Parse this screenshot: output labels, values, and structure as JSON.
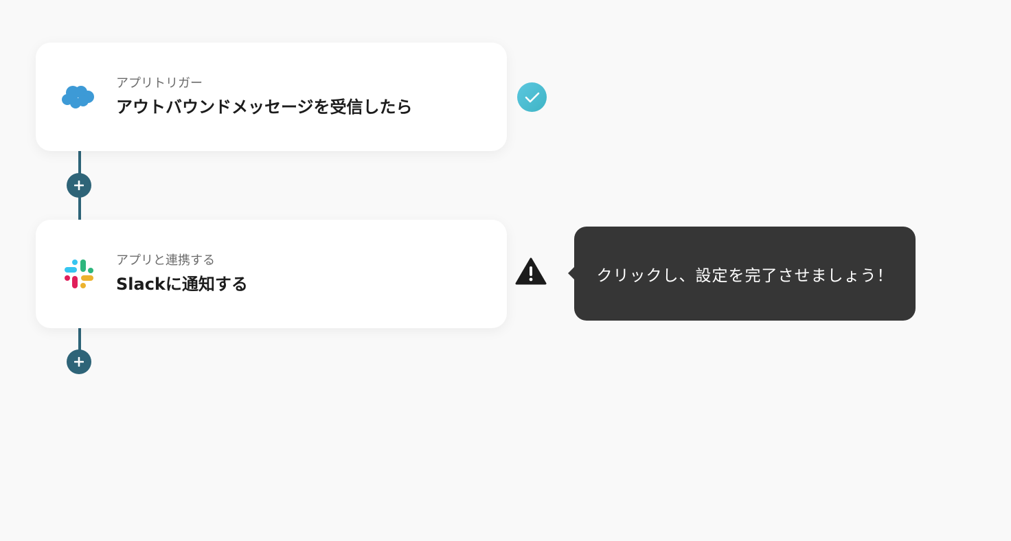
{
  "flow": {
    "steps": [
      {
        "subtitle": "アプリトリガー",
        "title": "アウトバウンドメッセージを受信したら",
        "icon": "salesforce-cloud-icon",
        "status": "completed",
        "status_icon": "check-circle-icon"
      },
      {
        "subtitle": "アプリと連携する",
        "title": "Slackに通知する",
        "icon": "slack-icon",
        "status": "incomplete",
        "status_icon": "warning-triangle-icon"
      }
    ],
    "add_buttons": [
      {
        "icon": "plus-icon"
      },
      {
        "icon": "plus-icon"
      }
    ]
  },
  "tooltip": {
    "text": "クリックし、設定を完了させましょう！"
  },
  "colors": {
    "background": "#f9f9f9",
    "connector": "#2e6478",
    "check": "#4fbfd3",
    "warning": "#1c1c1c",
    "tooltip_bg": "#363636",
    "salesforce": "#3d9ad6"
  }
}
